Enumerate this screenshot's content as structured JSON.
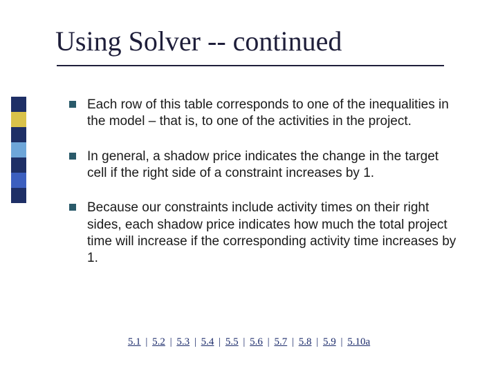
{
  "title": "Using Solver -- continued",
  "bullets": [
    "Each row of this table corresponds to one of the inequalities in the model – that is, to one of the activities in the project.",
    "In general, a shadow price indicates the change in the target cell if the right side of a constraint increases by 1.",
    "Because our constraints include activity times on their right sides, each shadow price indicates how much the total project time will increase if the corresponding activity time increases by 1."
  ],
  "footer_links": [
    "5.1",
    "5.2",
    "5.3",
    "5.4",
    "5.5",
    "5.6",
    "5.7",
    "5.8",
    "5.9",
    "5.10a"
  ],
  "footer_separator": "|"
}
